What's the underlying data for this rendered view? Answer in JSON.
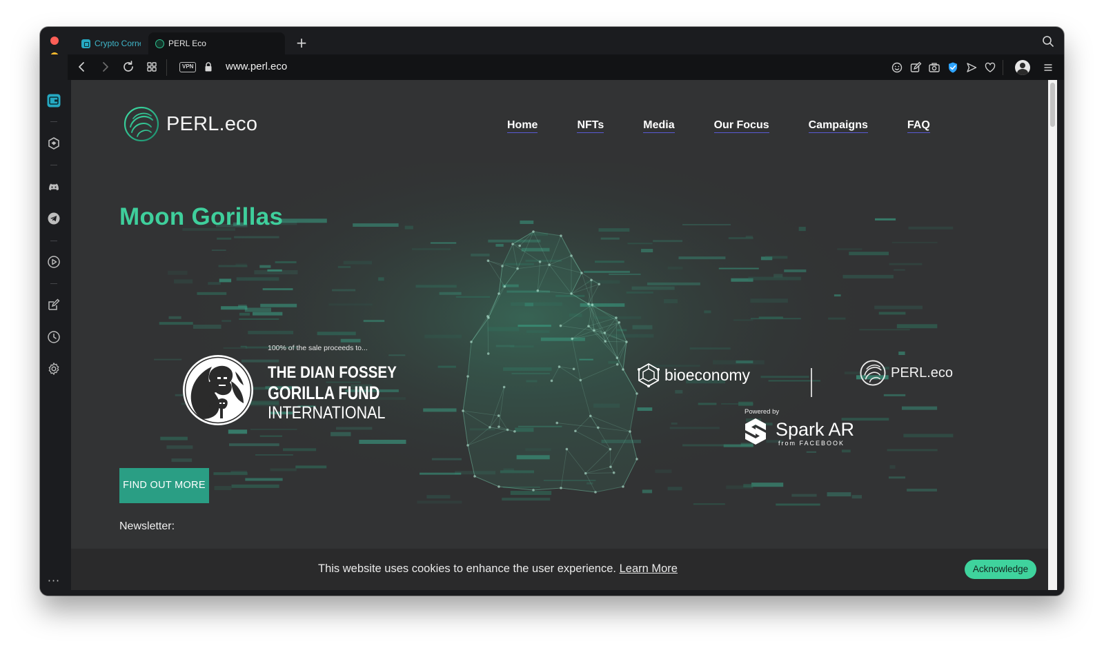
{
  "browser": {
    "tabs": [
      {
        "label": "Crypto Corner",
        "active": false
      },
      {
        "label": "PERL Eco",
        "active": true
      }
    ],
    "new_tab_glyph": "+",
    "address": {
      "vpn_label": "VPN",
      "url": "www.perl.eco"
    },
    "toolbar_icons": [
      "search-icon",
      "emoji-icon",
      "edit-icon",
      "camera-icon",
      "shield-icon",
      "send-icon",
      "heart-icon",
      "profile-icon",
      "menu-icon"
    ],
    "sidebar_icons": [
      "wallet-icon",
      "crypto-wallet-icon",
      "discord-icon",
      "telegram-icon",
      "player-icon",
      "pinboard-icon",
      "history-icon",
      "settings-icon"
    ],
    "sidebar_more": "···",
    "colors": {
      "accent": "#26a9c2",
      "shield": "#2ea4ff"
    }
  },
  "site": {
    "logo_text": "PERL.eco",
    "nav": [
      "Home",
      "NFTs",
      "Media",
      "Our Focus",
      "Campaigns",
      "FAQ"
    ],
    "hero": {
      "title": "Moon Gorillas",
      "fund": {
        "kicker": "100% of the sale proceeds to...",
        "line1": "THE DIAN FOSSEY",
        "line2": "GORILLA FUND",
        "line3": "INTERNATIONAL"
      },
      "bioeconomy": "bioeconomy",
      "perl_partner": "PERL.eco",
      "spark": {
        "kicker": "Powered by",
        "name": "Spark AR",
        "sub": "from FACEBOOK"
      },
      "cta": "FIND OUT MORE",
      "newsletter": "Newsletter:"
    },
    "cookie": {
      "text": "This website uses cookies to enhance the user experience.",
      "link": "Learn More",
      "button": "Acknowledge"
    },
    "colors": {
      "title": "#3fcf9c",
      "cta": "#2a9e84",
      "ack": "#3fd39d",
      "background": "#323334"
    }
  }
}
